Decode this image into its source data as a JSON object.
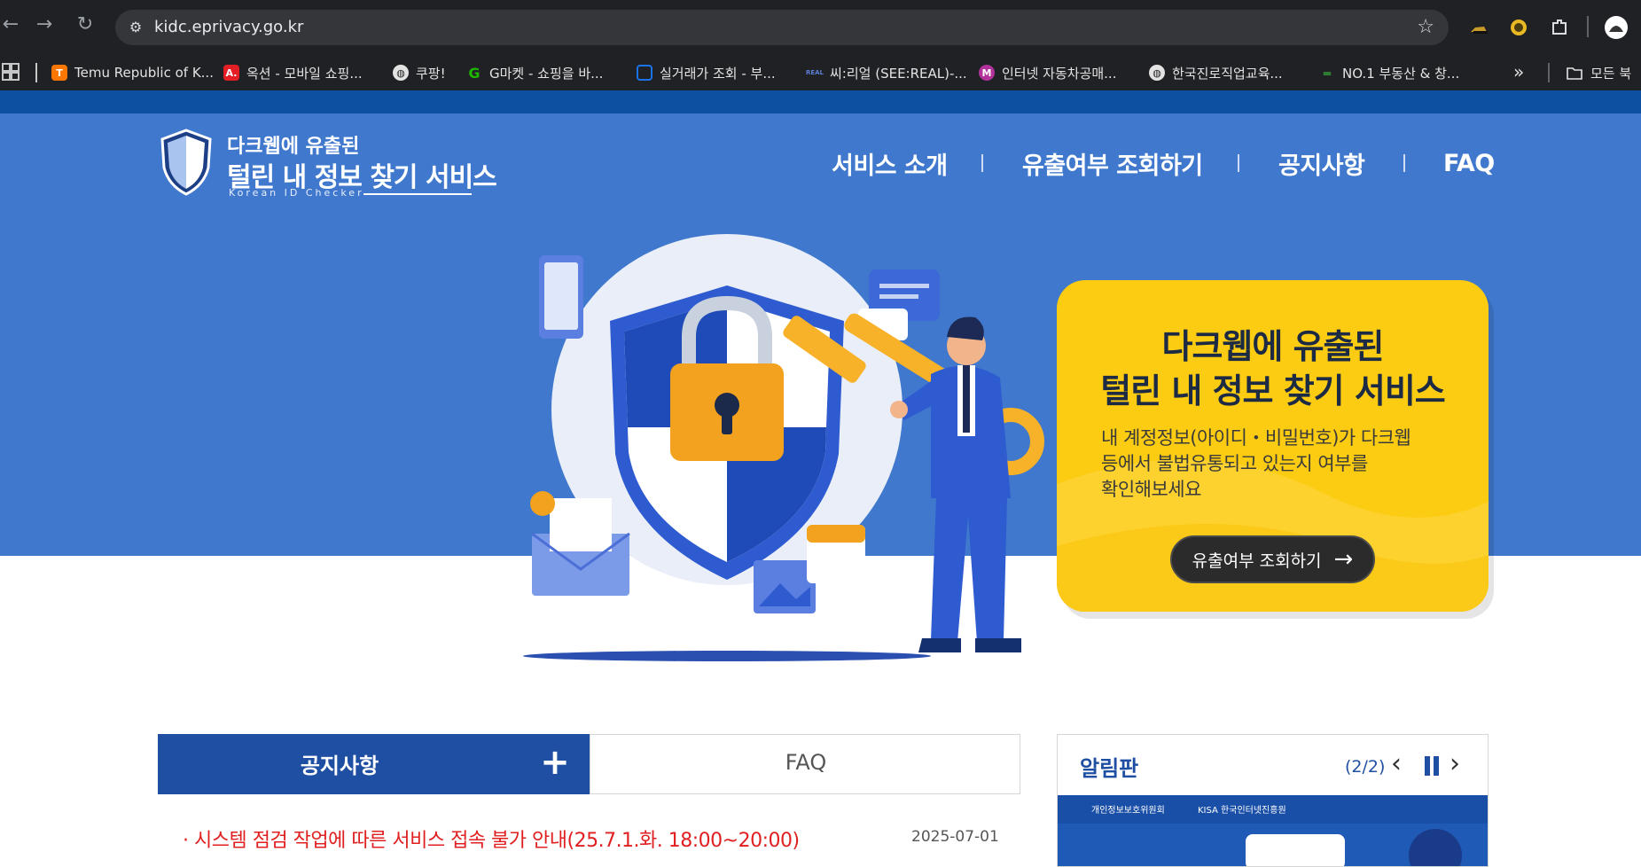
{
  "browser": {
    "url": "kidc.eprivacy.go.kr",
    "bookmarks": [
      {
        "label": "Temu Republic of K...",
        "icon": "temu-icon",
        "color": "#fb7701"
      },
      {
        "label": "옥션 - 모바일 쇼핑...",
        "icon": "auction-icon",
        "color": "#e31e24"
      },
      {
        "label": "쿠팡!",
        "icon": "globe-icon",
        "color": "#5f6368"
      },
      {
        "label": "G마켓 - 쇼핑을 바...",
        "icon": "gmarket-icon",
        "color": "#1fb600"
      },
      {
        "label": "실거래가 조회 - 부...",
        "icon": "realprice-icon",
        "color": "#1a73e8"
      },
      {
        "label": "씨:리얼 (SEE:REAL)-...",
        "icon": "seereal-icon",
        "color": "#2a4fa0"
      },
      {
        "label": "인터넷 자동차공매...",
        "icon": "auto-auction-icon",
        "color": "#b0329a"
      },
      {
        "label": "한국진로직업교육...",
        "icon": "globe-icon",
        "color": "#5f6368"
      },
      {
        "label": "NO.1 부동산 & 창...",
        "icon": "realestate-icon",
        "color": "#2e7d32"
      }
    ],
    "bookmarks_more": "»",
    "all_bookmarks": "모든 북"
  },
  "site": {
    "logo": {
      "line1": "다크웹에 유출된",
      "line2": "털린 내 정보 찾기 서비스",
      "sub": "Korean ID Checker"
    },
    "nav": [
      "서비스 소개",
      "유출여부 조회하기",
      "공지사항",
      "FAQ"
    ],
    "promo": {
      "title_line1": "다크웹에 유출된",
      "title_line2": "털린 내 정보 찾기 서비스",
      "desc_line1": "내 계정정보(아이디・비밀번호)가 다크웹",
      "desc_line2": "등에서 불법유통되고 있는지 여부를",
      "desc_line3": "확인해보세요",
      "button": "유출여부 조회하기"
    },
    "tabs": {
      "notice": "공지사항",
      "faq": "FAQ",
      "plus": "+"
    },
    "notices": [
      {
        "title": "· 시스템 점검 작업에 따른 서비스 접속 불가 안내(25.7.1.화. 18:00~20:00)",
        "date": "2025-07-01"
      }
    ],
    "board": {
      "title": "알림판",
      "count": "(2/2)",
      "banner_org1": "개인정보보호위원회",
      "banner_org2": "KISA 한국인터넷진흥원"
    }
  },
  "colors": {
    "hero_bg": "#3f78cd",
    "top_strip": "#0d4fa0",
    "promo_bg": "#fccc12",
    "notice_tab": "#1f4fa3",
    "notice_title": "#e02020"
  }
}
